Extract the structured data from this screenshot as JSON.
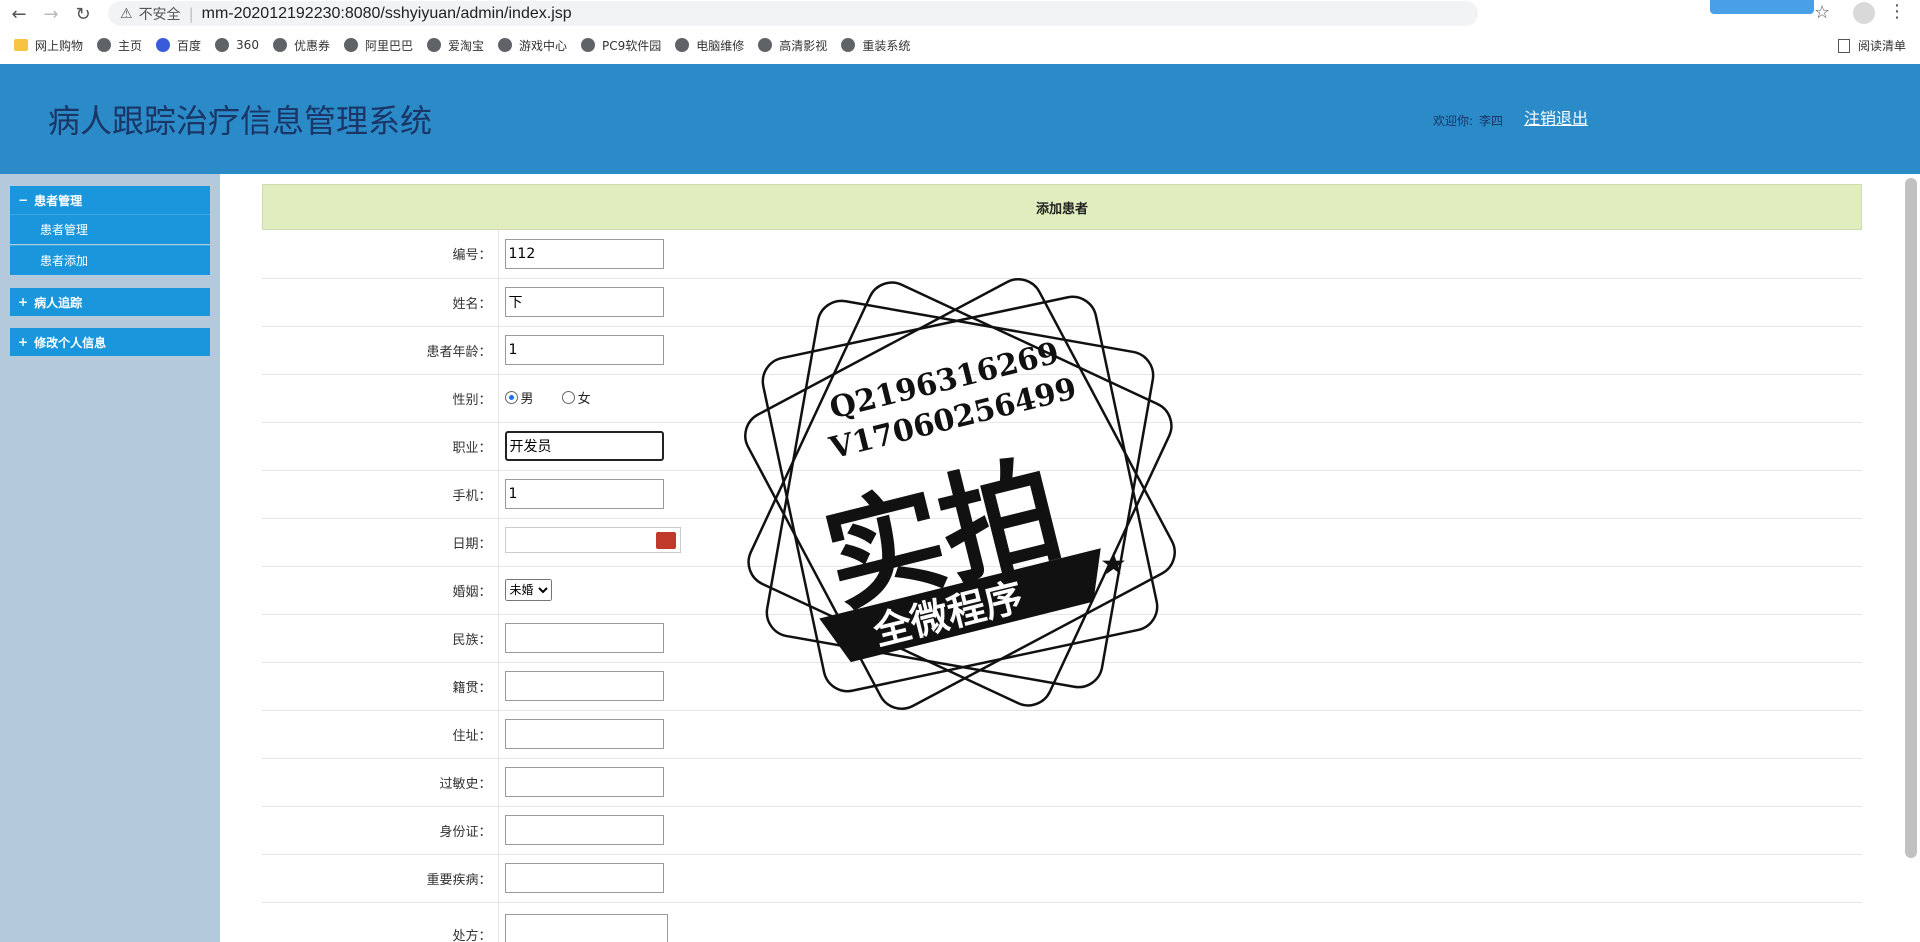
{
  "browser": {
    "insecure_label": "不安全",
    "url": "mm-202012192230:8080/sshyiyuan/admin/index.jsp",
    "bookmarks": [
      "网上购物",
      "主页",
      "百度",
      "360",
      "优惠券",
      "阿里巴巴",
      "爱淘宝",
      "游戏中心",
      "PC9软件园",
      "电脑维修",
      "高清影视",
      "重装系统"
    ],
    "reading_list": "阅读清单"
  },
  "header": {
    "title": "病人跟踪治疗信息管理系统",
    "welcome": "欢迎你:",
    "user": "李四",
    "logout": "注销退出"
  },
  "sidebar": {
    "groups": [
      {
        "sign": "−",
        "label": "患者管理",
        "items": [
          "患者管理",
          "患者添加"
        ]
      },
      {
        "sign": "+",
        "label": "病人追踪"
      },
      {
        "sign": "+",
        "label": "修改个人信息"
      }
    ]
  },
  "form": {
    "title": "添加患者",
    "fields": {
      "id": {
        "label": "编号：",
        "value": "112"
      },
      "name": {
        "label": "姓名：",
        "value": "下"
      },
      "age": {
        "label": "患者年龄：",
        "value": "1"
      },
      "gender": {
        "label": "性别：",
        "male": "男",
        "female": "女",
        "selected": "男"
      },
      "job": {
        "label": "职业：",
        "value": "开发员"
      },
      "phone": {
        "label": "手机：",
        "value": "1"
      },
      "date": {
        "label": "日期：",
        "value": ""
      },
      "marriage": {
        "label": "婚姻：",
        "value": "未婚"
      },
      "ethnic": {
        "label": "民族：",
        "value": ""
      },
      "origin": {
        "label": "籍贯：",
        "value": ""
      },
      "address": {
        "label": "住址：",
        "value": ""
      },
      "allergy": {
        "label": "过敏史：",
        "value": ""
      },
      "idcard": {
        "label": "身份证：",
        "value": ""
      },
      "disease": {
        "label": "重要疾病：",
        "value": ""
      },
      "prescription": {
        "label": "处方：",
        "value": ""
      }
    }
  },
  "watermark": {
    "line1": "Q2196316269",
    "line2": "V17060256499",
    "big": "实拍",
    "ribbon": "全微程序"
  }
}
